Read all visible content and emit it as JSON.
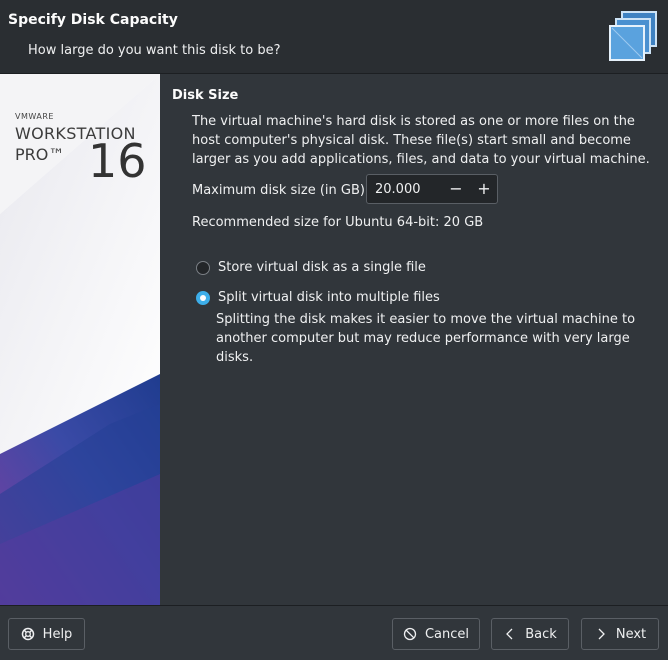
{
  "header": {
    "title": "Specify Disk Capacity",
    "subtitle": "How large do you want this disk to be?"
  },
  "banner": {
    "vmware": "VMWARE",
    "product": "WORKSTATION",
    "edition": "PRO™",
    "version": "16"
  },
  "section": {
    "title": "Disk Size",
    "description": "The virtual machine's hard disk is stored as one or more files on the host computer's physical disk. These file(s) start small and become larger as you add applications, files, and data to your virtual machine.",
    "max_size_label": "Maximum disk size (in GB):",
    "max_size_value": "20.000",
    "minus": "−",
    "plus": "+",
    "recommended": "Recommended size for Ubuntu 64-bit: 20 GB"
  },
  "options": {
    "single_label": "Store virtual disk as a single file",
    "single_checked": false,
    "split_label": "Split virtual disk into multiple files",
    "split_checked": true,
    "split_description": "Splitting the disk makes it easier to move the virtual machine to another computer but may reduce performance with very large disks."
  },
  "footer": {
    "help": "Help",
    "cancel": "Cancel",
    "back": "Back",
    "next": "Next"
  },
  "colors": {
    "accent": "#3daee9",
    "background": "#31363b"
  },
  "icons": [
    "disk-stack-icon",
    "lifebuoy-icon",
    "cancel-circle-icon",
    "chevron-left-icon",
    "chevron-right-icon"
  ]
}
